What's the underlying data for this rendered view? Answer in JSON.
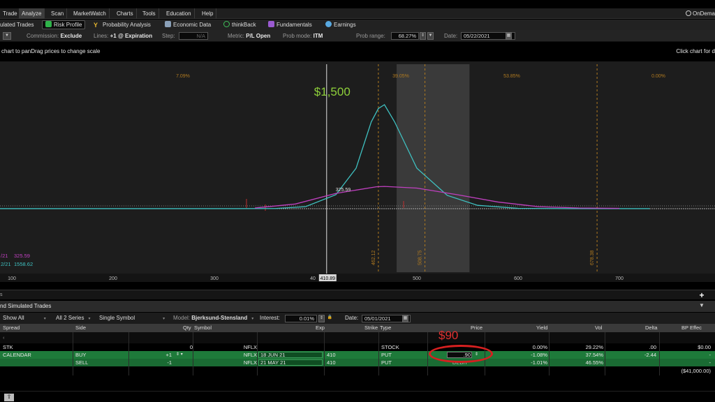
{
  "menu": {
    "items": [
      "Trade",
      "Analyze",
      "Scan",
      "MarketWatch",
      "Charts",
      "Tools",
      "Education",
      "Help"
    ],
    "active": "Analyze",
    "ondemand": "OnDema"
  },
  "toolbar1": {
    "simulated": "ulated Trades",
    "risk_profile": "Risk Profile",
    "probability": "Probability Analysis",
    "economic": "Economic Data",
    "thinkback": "thinkBack",
    "fundamentals": "Fundamentals",
    "earnings": "Earnings"
  },
  "toolbar2": {
    "commission_label": "Commission:",
    "commission_value": "Exclude",
    "lines_label": "Lines:",
    "lines_value": "+1 @ Expiration",
    "step_label": "Step:",
    "step_value": "N/A",
    "metric_label": "Metric:",
    "metric_value": "P/L Open",
    "probmode_label": "Prob mode:",
    "probmode_value": "ITM",
    "probrange_label": "Prob range:",
    "probrange_value": "68.27%",
    "date_label": "Date:",
    "date_value": "05/22/2021"
  },
  "hint": {
    "left": "chart to panDrag prices to change scale",
    "right": "Click chart for d"
  },
  "chart_data": {
    "type": "line",
    "x_ticks": [
      "100",
      "200",
      "300",
      "40",
      "500",
      "600",
      "700"
    ],
    "cursor_price": "410.89",
    "peak_label": "$1,500",
    "mid_label": "325.59",
    "top_pcts": [
      "7.09%",
      "39.05%",
      "53.85%",
      "0.00%"
    ],
    "vertical_labels": [
      "462.12",
      "508.75",
      "678.38"
    ],
    "legend": [
      {
        "label": "/21",
        "value": "325.59",
        "color": "#c040c0"
      },
      {
        "label": "2/21",
        "value": "1558.62",
        "color": "#3fc0c0"
      }
    ],
    "series": [
      {
        "name": "",
        "color": "#3fc0c0",
        "x": [
          0,
          320,
          360,
          390,
          420,
          440,
          455,
          462,
          468,
          478,
          500,
          530,
          560,
          600,
          650,
          730
        ],
        "y": [
          -10,
          -10,
          -8,
          20,
          200,
          600,
          1300,
          1500,
          1558,
          1300,
          600,
          190,
          40,
          -5,
          -10,
          -10
        ]
      },
      {
        "name": "",
        "color": "#c040c0",
        "x": [
          340,
          380,
          420,
          460,
          468,
          500,
          540,
          580,
          620,
          660,
          700
        ],
        "y": [
          0,
          60,
          220,
          320,
          325,
          300,
          200,
          90,
          20,
          0,
          -5
        ]
      }
    ],
    "xlim": [
      0,
      1024
    ],
    "shaded_range": [
      480,
      552
    ],
    "grid": false
  },
  "section": {
    "title": "nd Simulated Trades",
    "plus": "+",
    "collapse": "▼"
  },
  "filters": {
    "show": "Show All",
    "series": "All 2 Series",
    "symbol": "Single Symbol",
    "model_label": "Model:",
    "model_value": "Bjerksund-Stensland",
    "interest_label": "Interest:",
    "interest_value": "0.01%",
    "date_label": "Date:",
    "date_value": "05/01/2021"
  },
  "table": {
    "headers": [
      "Spread",
      "Side",
      "Qty",
      "Symbol",
      "Exp",
      "Strike",
      "Type",
      "Price",
      "Yield",
      "Vol",
      "Delta",
      "BP Effec"
    ],
    "rows": [
      {
        "spread": "STK",
        "side": "",
        "qty": "0",
        "symbol": "NFLX",
        "exp": "",
        "strike": "",
        "type": "STOCK",
        "price": "",
        "yield": "0.00%",
        "vol": "29.22%",
        "delta": ".00",
        "bp": "$0.00"
      },
      {
        "spread": "CALENDAR",
        "side": "BUY",
        "qty": "+1",
        "symbol": "NFLX",
        "exp": "18 JUN 21",
        "strike": "410",
        "type": "PUT",
        "price": ".90",
        "yield": "-1.08%",
        "vol": "37.54%",
        "delta": "-2.44",
        "bp": "-"
      },
      {
        "spread": "",
        "side": "SELL",
        "qty": "-1",
        "symbol": "NFLX",
        "exp": "21 MAY 21",
        "strike": "410",
        "type": "PUT",
        "price": "DEBIT",
        "yield": "-1.01%",
        "vol": "46.55%",
        "delta": "",
        "bp": "-"
      }
    ],
    "total_bp": "($41,000.00)"
  },
  "annotation": {
    "text": "$90"
  }
}
